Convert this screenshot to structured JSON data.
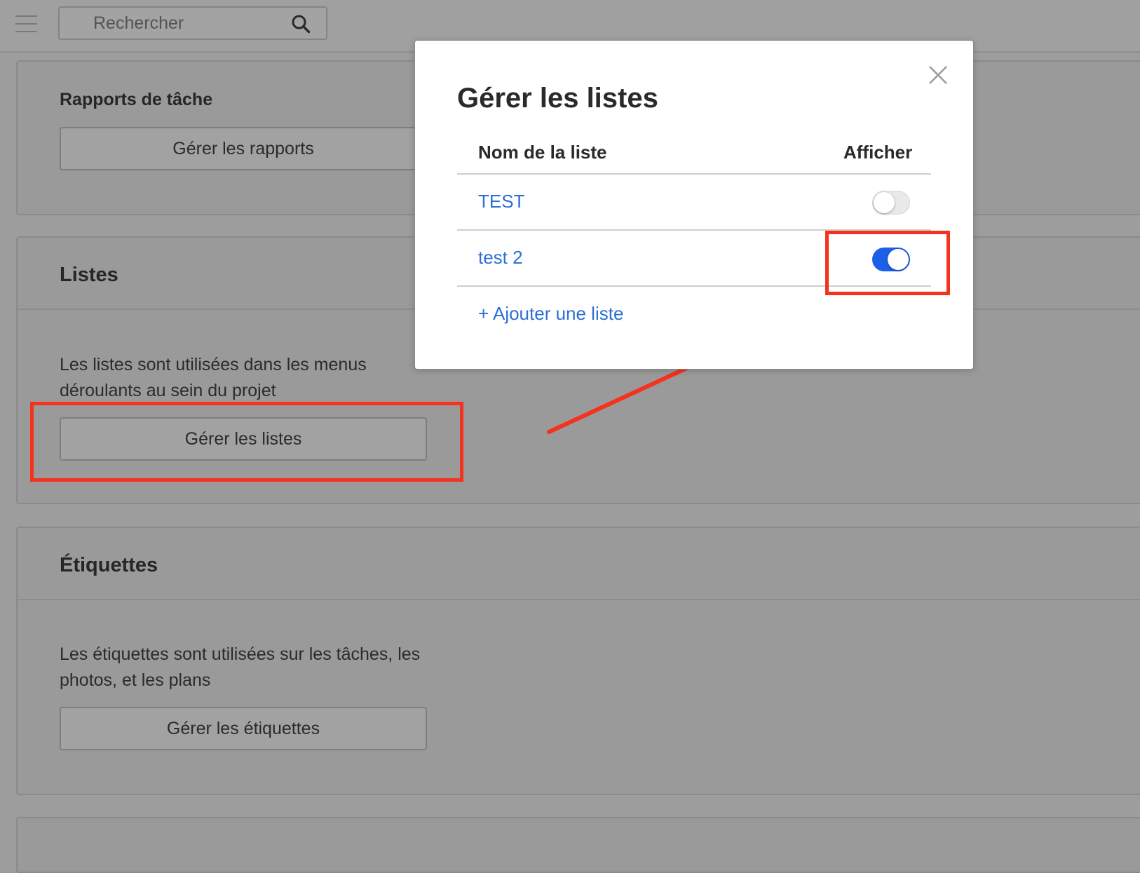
{
  "header": {
    "search_placeholder": "Rechercher",
    "menu_icon": "hamburger-icon",
    "search_icon": "search-icon"
  },
  "cards": {
    "reports": {
      "title": "Rapports de tâche",
      "button": "Gérer les rapports"
    },
    "lists": {
      "title": "Listes",
      "description": "Les listes sont utilisées dans les menus déroulants au sein du projet",
      "button": "Gérer les listes"
    },
    "labels": {
      "title": "Étiquettes",
      "description": "Les étiquettes sont utilisées sur les tâches, les photos, et les plans",
      "button": "Gérer les étiquettes"
    }
  },
  "modal": {
    "title": "Gérer les listes",
    "col_name": "Nom de la liste",
    "col_show": "Afficher",
    "rows": [
      {
        "name": "TEST",
        "shown": false
      },
      {
        "name": "test 2",
        "shown": true
      }
    ],
    "add_label": "+ Ajouter une liste"
  },
  "colors": {
    "accent_blue": "#1c5fe8",
    "link_blue": "#2e6fd6",
    "annotation_red": "#f4321e",
    "overlay_gray": "#9d9d9d"
  }
}
